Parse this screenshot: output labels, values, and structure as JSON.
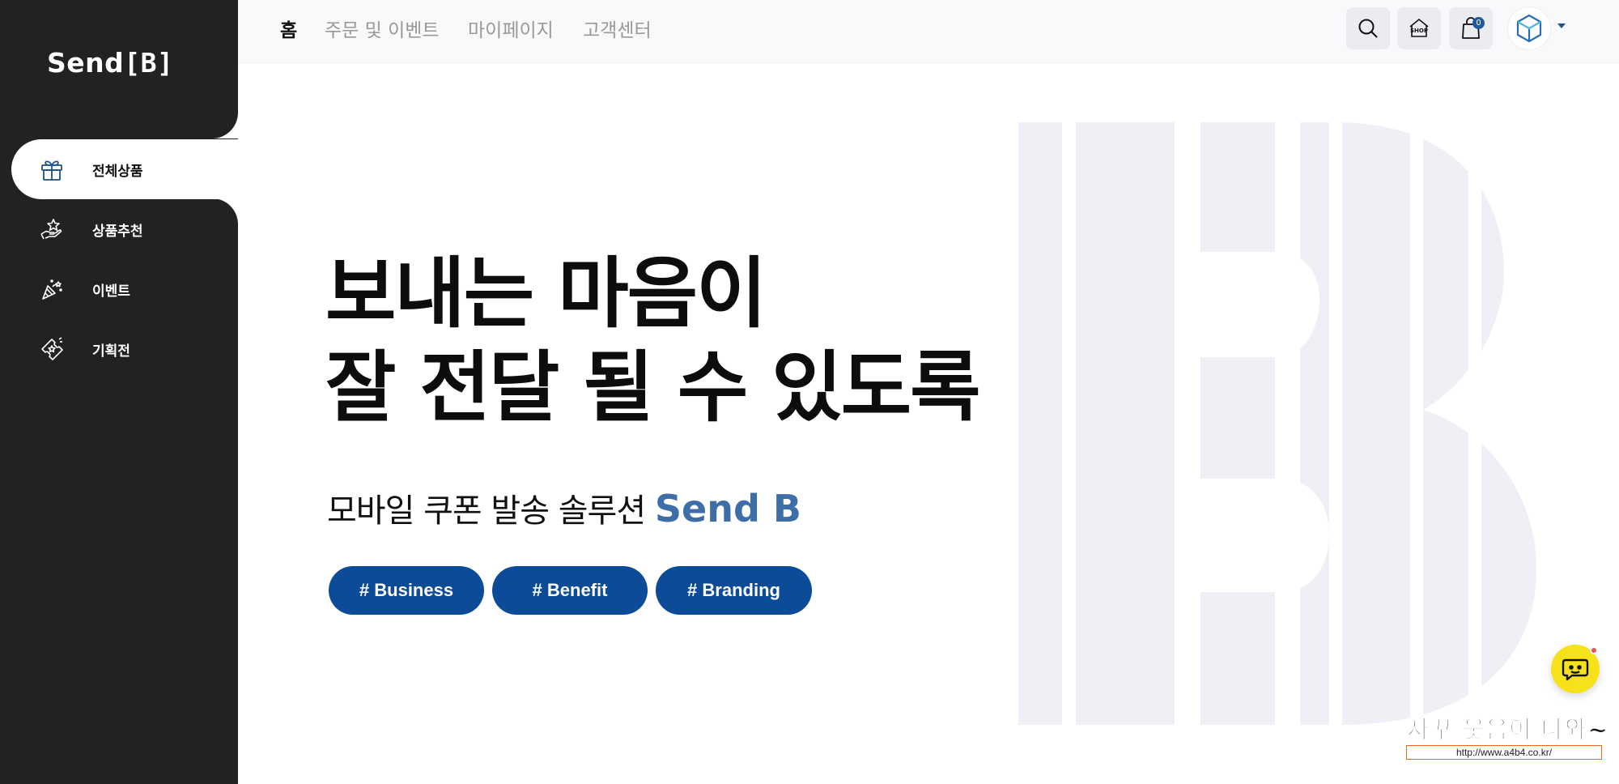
{
  "brand": {
    "logo_text": "Send",
    "logo_mark": "[B]"
  },
  "sidebar": {
    "items": [
      {
        "label": "전체상품",
        "icon": "gift-icon",
        "active": true
      },
      {
        "label": "상품추천",
        "icon": "hand-star-icon",
        "active": false
      },
      {
        "label": "이벤트",
        "icon": "party-popper-icon",
        "active": false
      },
      {
        "label": "기획전",
        "icon": "ticket-star-icon",
        "active": false
      }
    ]
  },
  "header": {
    "nav": [
      {
        "label": "홈",
        "active": true
      },
      {
        "label": "주문 및 이벤트",
        "active": false
      },
      {
        "label": "마이페이지",
        "active": false
      },
      {
        "label": "고객센터",
        "active": false
      }
    ],
    "actions": {
      "search_icon": "search-icon",
      "shop_label": "SHOP",
      "cart_count": "0"
    }
  },
  "hero": {
    "title_line1": "보내는 마음이",
    "title_line2": "잘 전달 될 수 있도록",
    "subtitle": "모바일 쿠폰 발송 솔루션",
    "subtitle_brand": "Send B",
    "tags": [
      "# Business",
      "# Benefit",
      "# Branding"
    ]
  },
  "watermark": {
    "script": "자꾸 웃음이 나와~",
    "url": "http://www.a4b4.co.kr/"
  },
  "colors": {
    "sidebar_bg": "#222222",
    "brand_blue": "#0b4b98",
    "accent_blue": "#3e6ea8",
    "hero_mark": "#eef0f5",
    "chat_yellow": "#f5e21a"
  }
}
